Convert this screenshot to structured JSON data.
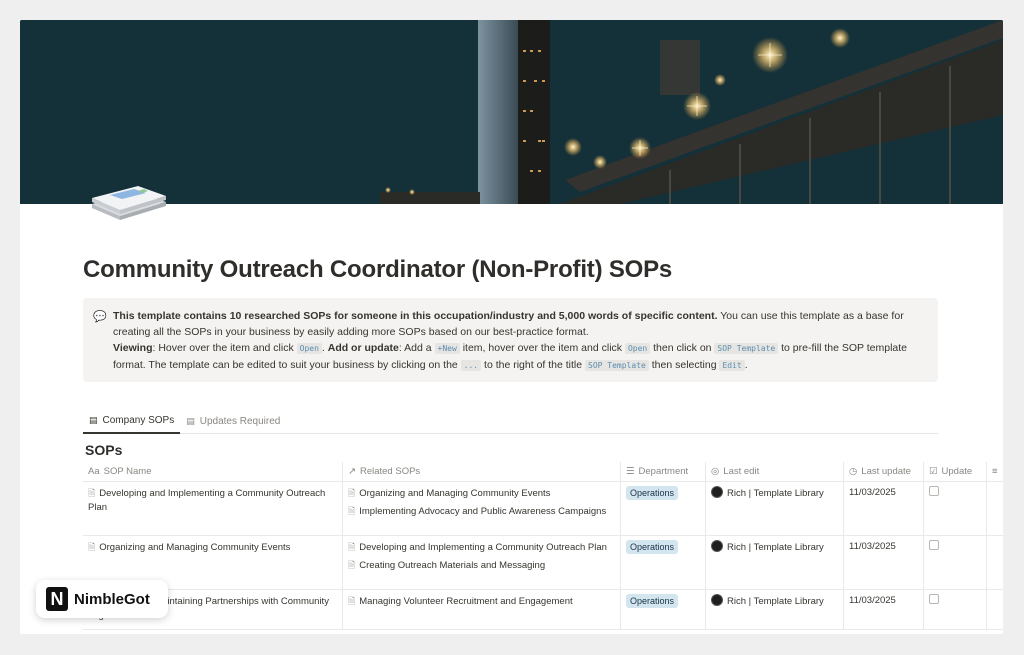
{
  "page": {
    "title": "Community Outreach Coordinator (Non-Profit) SOPs"
  },
  "callout": {
    "icon": "speech-bubble-icon",
    "intro_bold": "This template contains 10 researched SOPs for someone in this occupation/industry and 5,000 words of specific content.",
    "intro_rest": " You can use this template as a base for creating all the SOPs in your business by easily adding more SOPs based on our best-practice format.",
    "viewing_label": "Viewing",
    "viewing_text": ": Hover over the item and click ",
    "open_code": "Open",
    "add_label": "Add or update",
    "add_text_1": ": Add a ",
    "new_code": "+New",
    "add_text_2": " item, hover over the item and click ",
    "add_text_3": " then click on ",
    "sop_code": "SOP Template",
    "add_text_4": " to pre-fill the SOP template format. The template can be edited to suit your business by clicking on the ",
    "dots_code": "...",
    "add_text_5": " to the right of the title ",
    "add_text_6": " then selecting ",
    "edit_code": "Edit",
    "add_text_7": "."
  },
  "tabs": [
    {
      "label": "Company SOPs",
      "active": true
    },
    {
      "label": "Updates Required",
      "active": false
    }
  ],
  "section_title": "SOPs",
  "table": {
    "headers": {
      "name": "SOP Name",
      "related": "Related SOPs",
      "department": "Department",
      "last_edit": "Last edit",
      "last_update": "Last update",
      "update": "Update"
    },
    "header_icons": {
      "name": "Aa",
      "related": "↗",
      "department": "☰",
      "last_edit": "◎",
      "last_update": "◷",
      "update": "☑"
    },
    "rows": [
      {
        "name": "Developing and Implementing a Community Outreach Plan",
        "related": [
          "Organizing and Managing Community Events",
          "Implementing Advocacy and Public Awareness Campaigns"
        ],
        "department": "Operations",
        "last_edit": "Rich | Template Library",
        "last_update": "11/03/2025"
      },
      {
        "name": "Organizing and Managing Community Events",
        "related": [
          "Developing and Implementing a Community Outreach Plan",
          "Creating Outreach Materials and Messaging"
        ],
        "department": "Operations",
        "last_edit": "Rich | Template Library",
        "last_update": "11/03/2025"
      },
      {
        "name": "Building and Maintaining Partnerships with Community Organizations",
        "related": [
          "Managing Volunteer Recruitment and Engagement"
        ],
        "department": "Operations",
        "last_edit": "Rich | Template Library",
        "last_update": "11/03/2025"
      }
    ]
  },
  "brand": {
    "logo_letter": "N",
    "name": "NimbleGot"
  },
  "colors": {
    "tag_bg": "#d3e5ef",
    "code_text": "#5a8db0"
  }
}
